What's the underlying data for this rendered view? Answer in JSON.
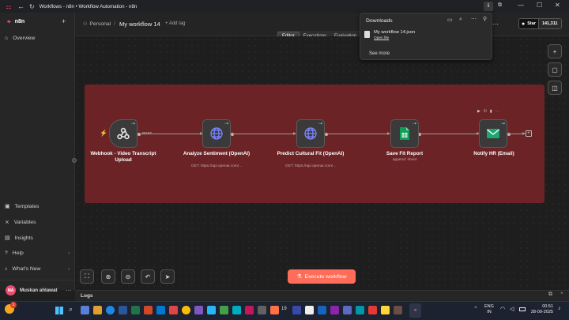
{
  "browser": {
    "tab_title": "Workflows - n8n • Workflow Automation - n8n"
  },
  "sidebar": {
    "logo": "n8n",
    "items": [
      {
        "label": "Overview",
        "icon": "home-icon"
      },
      {
        "label": "Templates",
        "icon": "templates-icon"
      },
      {
        "label": "Variables",
        "icon": "variables-icon"
      },
      {
        "label": "Insights",
        "icon": "insights-icon"
      },
      {
        "label": "Help",
        "icon": "help-icon"
      },
      {
        "label": "What's New",
        "icon": "bell-icon"
      }
    ],
    "user": {
      "initials": "MA",
      "name": "Muskan ahlawat"
    }
  },
  "header": {
    "project": "Personal",
    "workflow_name": "My workflow 14",
    "add_tag": "+ Add tag",
    "tabs": [
      "Editor",
      "Executions",
      "Evaluation"
    ],
    "active_tab": "Editor",
    "github": {
      "label": "Star",
      "count": "141,311"
    }
  },
  "downloads": {
    "title": "Downloads",
    "file_name": "My workflow 14.json",
    "file_action": "Open file",
    "see_more": "See more"
  },
  "workflow": {
    "nodes": [
      {
        "title": "Webhook - Video Transcript Upload",
        "subtitle": "",
        "icon": "webhook-icon",
        "badge": "POST"
      },
      {
        "title": "Analyze Sentiment (OpenAI)",
        "subtitle": "GET: https://api.openai.com/...",
        "icon": "globe-icon"
      },
      {
        "title": "Predict Cultural Fit (OpenAI)",
        "subtitle": "GET: https://api.openai.com/...",
        "icon": "globe-icon"
      },
      {
        "title": "Save Fit Report",
        "subtitle": "append: sheet",
        "icon": "google-sheets-icon"
      },
      {
        "title": "Notify HR (Email)",
        "subtitle": "",
        "icon": "email-icon"
      }
    ],
    "execute_button": "Execute workflow"
  },
  "logs": {
    "label": "Logs"
  },
  "taskbar": {
    "lang": "ENG",
    "region": "IN",
    "time": "00:51",
    "date": "28-09-2025",
    "notification_count": "19"
  },
  "colors": {
    "accent": "#ea4b71",
    "sticky": "#6b2326",
    "execute": "#ff6d5a",
    "sheets": "#0f9d58",
    "email": "#1ea672"
  }
}
